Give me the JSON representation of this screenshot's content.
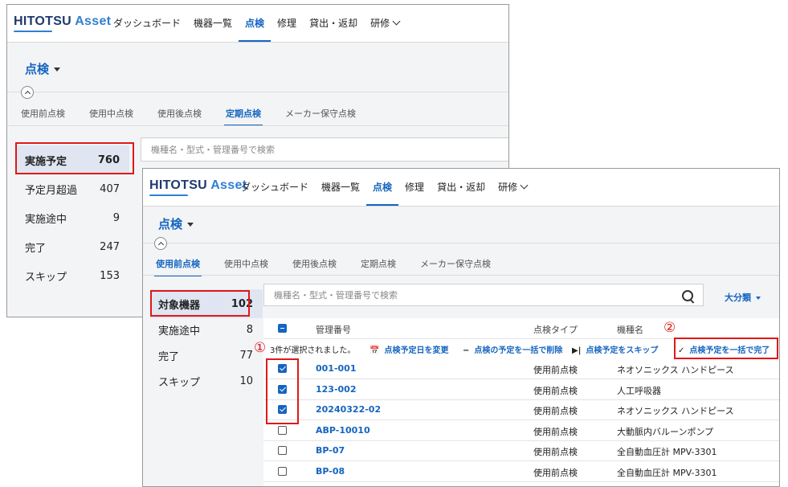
{
  "brand": {
    "hitotsu": "HITOTSU",
    "asset": "Asset"
  },
  "nav": {
    "items": [
      "ダッシュボード",
      "機器一覧",
      "点検",
      "修理",
      "貸出・返却",
      "研修"
    ],
    "active_index": 2
  },
  "back": {
    "page_title": "点検",
    "tabs": [
      "使用前点検",
      "使用中点検",
      "使用後点検",
      "定期点検",
      "メーカー保守点検"
    ],
    "active_tab": 3,
    "sidebar": [
      {
        "label": "実施予定",
        "count": "760"
      },
      {
        "label": "予定月超過",
        "count": "407"
      },
      {
        "label": "実施途中",
        "count": "9"
      },
      {
        "label": "完了",
        "count": "247"
      },
      {
        "label": "スキップ",
        "count": "153"
      }
    ],
    "search_placeholder": "機種名・型式・管理番号で検索"
  },
  "front": {
    "page_title": "点検",
    "tabs": [
      "使用前点検",
      "使用中点検",
      "使用後点検",
      "定期点検",
      "メーカー保守点検"
    ],
    "active_tab": 0,
    "sidebar": [
      {
        "label": "対象機器",
        "count": "102"
      },
      {
        "label": "実施途中",
        "count": "8"
      },
      {
        "label": "完了",
        "count": "77"
      },
      {
        "label": "スキップ",
        "count": "10"
      }
    ],
    "search_placeholder": "機種名・型式・管理番号で検索",
    "filter_label": "大分類",
    "table": {
      "headers": [
        "管理番号",
        "点検タイプ",
        "機種名"
      ],
      "selection_text": "3件が選択されました。",
      "actions": [
        {
          "icon": "📅",
          "label": "点検予定日を変更"
        },
        {
          "icon": "−",
          "label": "点検の予定を一括で削除"
        },
        {
          "icon": "▶|",
          "label": "点検予定をスキップ"
        },
        {
          "icon": "✓",
          "label": "点検予定を一括で完了"
        }
      ],
      "rows": [
        {
          "id": "001-001",
          "type": "使用前点検",
          "model": "ネオソニックス ハンドピース",
          "checked": true
        },
        {
          "id": "123-002",
          "type": "使用前点検",
          "model": "人工呼吸器",
          "checked": true
        },
        {
          "id": "20240322-02",
          "type": "使用前点検",
          "model": "ネオソニックス ハンドピース",
          "checked": true
        },
        {
          "id": "ABP-10010",
          "type": "使用前点検",
          "model": "大動脈内バルーンポンプ",
          "checked": false
        },
        {
          "id": "BP-07",
          "type": "使用前点検",
          "model": "全自動血圧計 MPV-3301",
          "checked": false
        },
        {
          "id": "BP-08",
          "type": "使用前点検",
          "model": "全自動血圧計 MPV-3301",
          "checked": false
        }
      ]
    }
  },
  "annotations": {
    "one": "①",
    "two": "②"
  },
  "colors": {
    "accent": "#1565c0",
    "highlight": "#e01818",
    "selected_bg": "#dfe6f2"
  }
}
